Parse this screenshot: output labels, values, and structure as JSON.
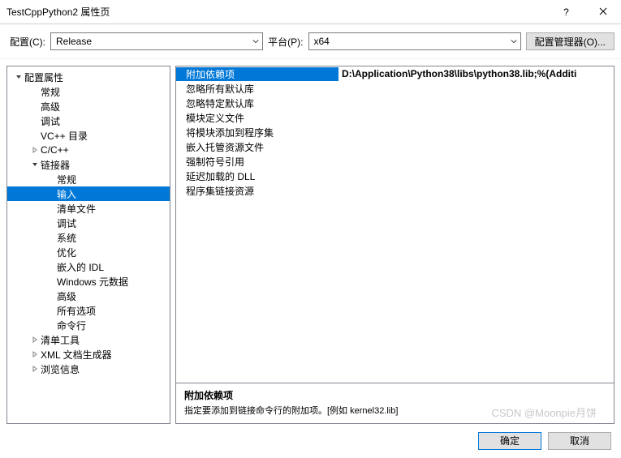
{
  "title": "TestCppPython2 属性页",
  "helpGlyph": "?",
  "configLabel": "配置(C):",
  "configValue": "Release",
  "platformLabel": "平台(P):",
  "platformValue": "x64",
  "managerBtn": "配置管理器(O)...",
  "tree": [
    {
      "label": "配置属性",
      "depth": 0,
      "exp": true
    },
    {
      "label": "常规",
      "depth": 1
    },
    {
      "label": "高级",
      "depth": 1
    },
    {
      "label": "调试",
      "depth": 1
    },
    {
      "label": "VC++ 目录",
      "depth": 1
    },
    {
      "label": "C/C++",
      "depth": 1,
      "exp": false,
      "hasChildren": true
    },
    {
      "label": "链接器",
      "depth": 1,
      "exp": true,
      "hasChildren": true
    },
    {
      "label": "常规",
      "depth": 2
    },
    {
      "label": "输入",
      "depth": 2,
      "sel": true
    },
    {
      "label": "清单文件",
      "depth": 2
    },
    {
      "label": "调试",
      "depth": 2
    },
    {
      "label": "系统",
      "depth": 2
    },
    {
      "label": "优化",
      "depth": 2
    },
    {
      "label": "嵌入的 IDL",
      "depth": 2
    },
    {
      "label": "Windows 元数据",
      "depth": 2
    },
    {
      "label": "高级",
      "depth": 2
    },
    {
      "label": "所有选项",
      "depth": 2
    },
    {
      "label": "命令行",
      "depth": 2
    },
    {
      "label": "清单工具",
      "depth": 1,
      "exp": false,
      "hasChildren": true
    },
    {
      "label": "XML 文档生成器",
      "depth": 1,
      "exp": false,
      "hasChildren": true
    },
    {
      "label": "浏览信息",
      "depth": 1,
      "exp": false,
      "hasChildren": true
    }
  ],
  "grid": [
    {
      "k": "附加依赖项",
      "v": "D:\\Application\\Python38\\libs\\python38.lib;%(Additi",
      "sel": true
    },
    {
      "k": "忽略所有默认库",
      "v": ""
    },
    {
      "k": "忽略特定默认库",
      "v": ""
    },
    {
      "k": "模块定义文件",
      "v": ""
    },
    {
      "k": "将模块添加到程序集",
      "v": ""
    },
    {
      "k": "嵌入托管资源文件",
      "v": ""
    },
    {
      "k": "强制符号引用",
      "v": ""
    },
    {
      "k": "延迟加载的 DLL",
      "v": ""
    },
    {
      "k": "程序集链接资源",
      "v": ""
    }
  ],
  "desc": {
    "title": "附加依赖项",
    "text": "指定要添加到链接命令行的附加项。[例如 kernel32.lib]"
  },
  "okBtn": "确定",
  "cancelBtn": "取消",
  "watermark": "CSDN @Moonpie月饼"
}
